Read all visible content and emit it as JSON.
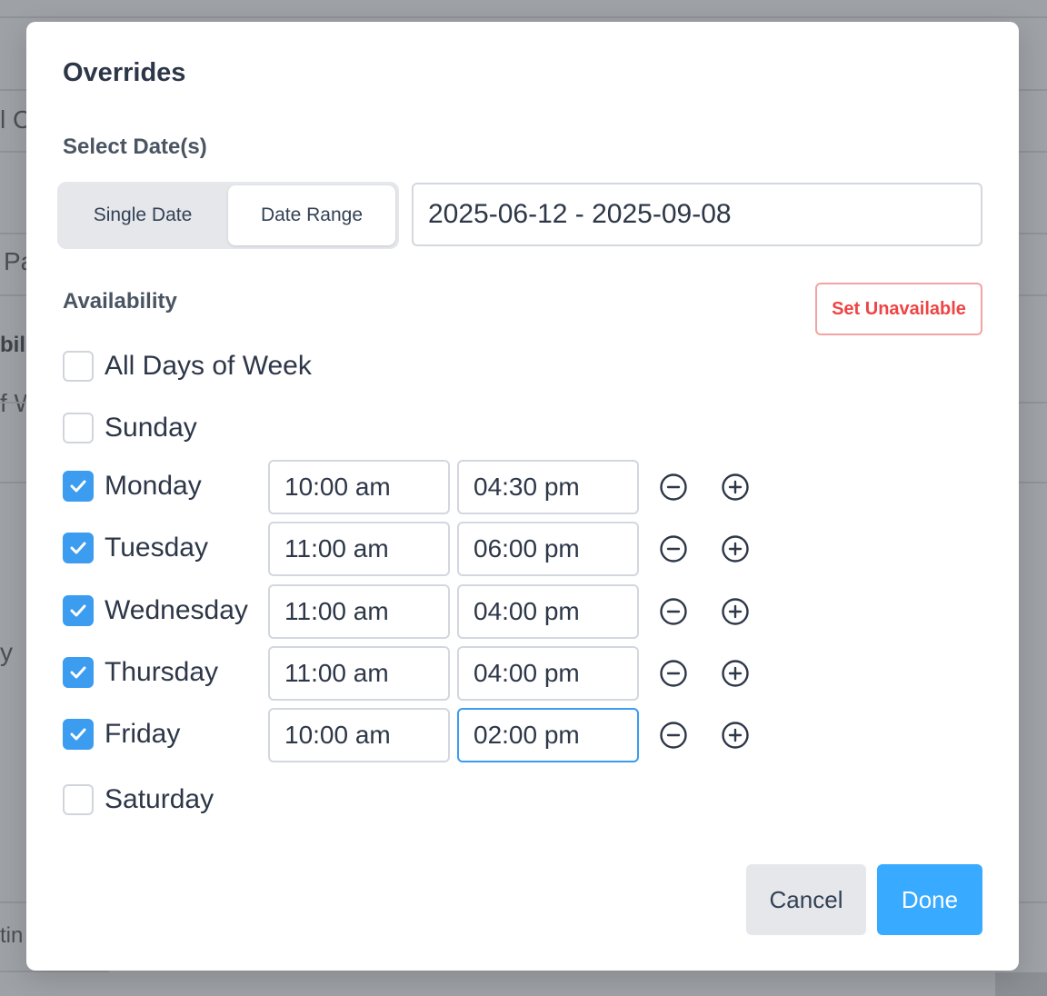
{
  "background": {
    "fragments": [
      "l C",
      "Pa",
      "bil",
      "f W",
      "y",
      "tin"
    ]
  },
  "modal": {
    "title": "Overrides",
    "select_dates_label": "Select Date(s)",
    "date_mode": {
      "options": [
        "Single Date",
        "Date Range"
      ],
      "selected": "Date Range"
    },
    "date_value": "2025-06-12 - 2025-09-08",
    "availability_label": "Availability",
    "set_unavailable_label": "Set Unavailable",
    "all_days": {
      "label": "All Days of Week",
      "checked": false
    },
    "days": [
      {
        "label": "Sunday",
        "checked": false
      },
      {
        "label": "Monday",
        "checked": true,
        "from": "10:00 am",
        "to": "04:30 pm"
      },
      {
        "label": "Tuesday",
        "checked": true,
        "from": "11:00 am",
        "to": "06:00 pm"
      },
      {
        "label": "Wednesday",
        "checked": true,
        "from": "11:00 am",
        "to": "04:00 pm"
      },
      {
        "label": "Thursday",
        "checked": true,
        "from": "11:00 am",
        "to": "04:00 pm"
      },
      {
        "label": "Friday",
        "checked": true,
        "from": "10:00 am",
        "to": "02:00 pm"
      },
      {
        "label": "Saturday",
        "checked": false
      }
    ],
    "cancel_label": "Cancel",
    "done_label": "Done"
  },
  "colors": {
    "accent": "#38aaff",
    "checkbox": "#3b9cf0",
    "danger": "#ef4444"
  },
  "icons": {
    "remove": "minus-circle-icon",
    "add": "plus-circle-icon",
    "check": "check-icon"
  }
}
